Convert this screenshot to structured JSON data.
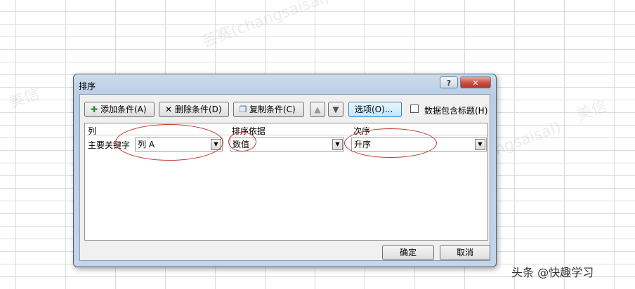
{
  "watermarks": [
    "芸赛(changsaisai)",
    "美信",
    "芸赛(changsaisai) 美信",
    "芸赛(changsaisai)",
    "美信"
  ],
  "dialog": {
    "title": "排序",
    "help_label": "?",
    "close_label": "✕",
    "toolbar": {
      "add_label": "添加条件(A)",
      "delete_label": "删除条件(D)",
      "copy_label": "复制条件(C)",
      "up_label": "▲",
      "down_label": "▼",
      "options_label": "选项(O)...",
      "header_checkbox_label": "数据包含标题(H)"
    },
    "grid": {
      "headers": {
        "column": "列",
        "sort_on": "排序依据",
        "order": "次序"
      },
      "rows": [
        {
          "label": "主要关键字",
          "column_value": "列 A",
          "sort_on_value": "数值",
          "order_value": "升序"
        }
      ]
    },
    "ok_label": "确定",
    "cancel_label": "取消"
  },
  "footer_text": "头条 @快趣学习",
  "colors": {
    "annotation_circle": "#c0392b",
    "dialog_frame": "#bcd0e6"
  }
}
